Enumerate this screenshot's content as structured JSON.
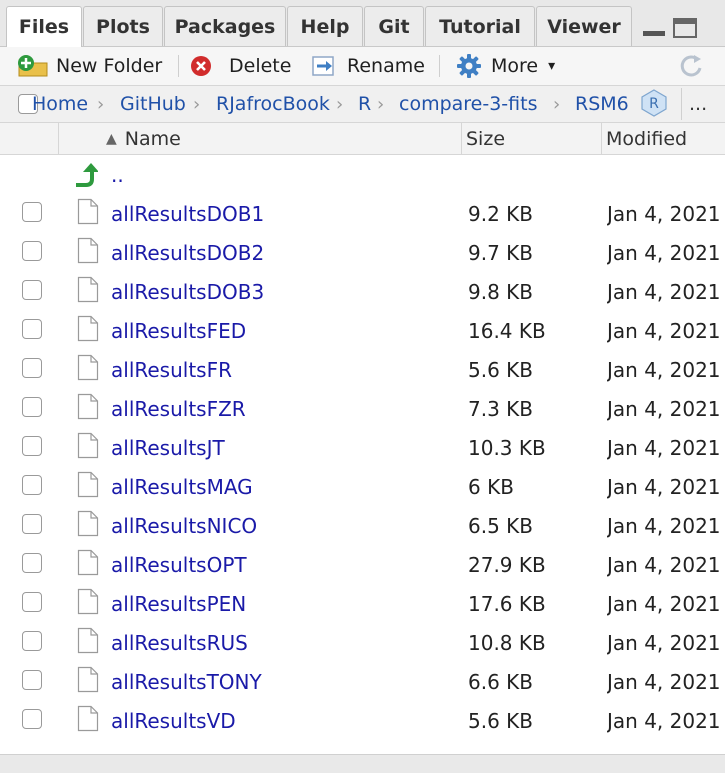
{
  "tabs": [
    {
      "label": "Files",
      "active": true
    },
    {
      "label": "Plots"
    },
    {
      "label": "Packages"
    },
    {
      "label": "Help"
    },
    {
      "label": "Git"
    },
    {
      "label": "Tutorial"
    },
    {
      "label": "Viewer"
    }
  ],
  "toolbar": {
    "new_folder": "New Folder",
    "delete": "Delete",
    "rename": "Rename",
    "more": "More",
    "more_arrow": "▾"
  },
  "breadcrumb": {
    "items": [
      "Home",
      "GitHub",
      "RJafrocBook",
      "R",
      "compare-3-fits",
      "RSM6"
    ],
    "separator": "›",
    "overflow": "..."
  },
  "columns": {
    "sort_arrow": "▲",
    "name": "Name",
    "size": "Size",
    "modified": "Modified"
  },
  "parent_dir": "..",
  "files": [
    {
      "name": "allResultsDOB1",
      "size": "9.2 KB",
      "modified": "Jan 4, 2021"
    },
    {
      "name": "allResultsDOB2",
      "size": "9.7 KB",
      "modified": "Jan 4, 2021"
    },
    {
      "name": "allResultsDOB3",
      "size": "9.8 KB",
      "modified": "Jan 4, 2021"
    },
    {
      "name": "allResultsFED",
      "size": "16.4 KB",
      "modified": "Jan 4, 2021"
    },
    {
      "name": "allResultsFR",
      "size": "5.6 KB",
      "modified": "Jan 4, 2021"
    },
    {
      "name": "allResultsFZR",
      "size": "7.3 KB",
      "modified": "Jan 4, 2021"
    },
    {
      "name": "allResultsJT",
      "size": "10.3 KB",
      "modified": "Jan 4, 2021"
    },
    {
      "name": "allResultsMAG",
      "size": "6 KB",
      "modified": "Jan 4, 2021"
    },
    {
      "name": "allResultsNICO",
      "size": "6.5 KB",
      "modified": "Jan 4, 2021"
    },
    {
      "name": "allResultsOPT",
      "size": "27.9 KB",
      "modified": "Jan 4, 2021"
    },
    {
      "name": "allResultsPEN",
      "size": "17.6 KB",
      "modified": "Jan 4, 2021"
    },
    {
      "name": "allResultsRUS",
      "size": "10.8 KB",
      "modified": "Jan 4, 2021"
    },
    {
      "name": "allResultsTONY",
      "size": "6.6 KB",
      "modified": "Jan 4, 2021"
    },
    {
      "name": "allResultsVD",
      "size": "5.6 KB",
      "modified": "Jan 4, 2021"
    }
  ],
  "colors": {
    "link": "#1a1aa8",
    "breadcrumb": "#2051a8",
    "up_arrow": "#2e9a3e",
    "delete_red": "#d12c2c",
    "gear_blue": "#3f7fc4"
  }
}
